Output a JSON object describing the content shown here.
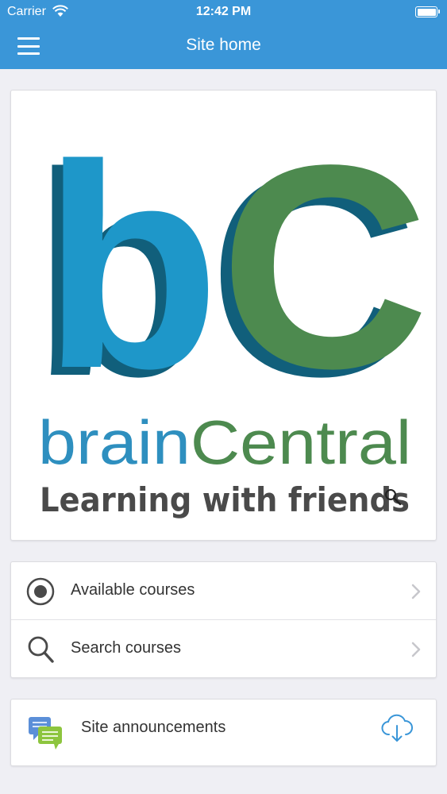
{
  "status_bar": {
    "carrier": "Carrier",
    "time": "12:42 PM"
  },
  "navbar": {
    "title": "Site home",
    "menu_icon": "hamburger-menu-icon"
  },
  "logo": {
    "letters": "bC",
    "brand_part1": "brain",
    "brand_part2": "Central",
    "tagline": "Learning with friends",
    "colors": {
      "blue": "#1e97c9",
      "blue_dark": "#115f7b",
      "green": "#4d8a4f",
      "tagline": "#4a4a4a"
    }
  },
  "menu": {
    "items": [
      {
        "label": "Available courses",
        "icon": "radio-target-icon"
      },
      {
        "label": "Search courses",
        "icon": "search-icon"
      }
    ]
  },
  "announcements": {
    "label": "Site announcements",
    "icon": "chat-bubbles-icon",
    "action_icon": "cloud-download-icon"
  },
  "colors": {
    "accent": "#3a96d8",
    "background": "#efeff4"
  }
}
